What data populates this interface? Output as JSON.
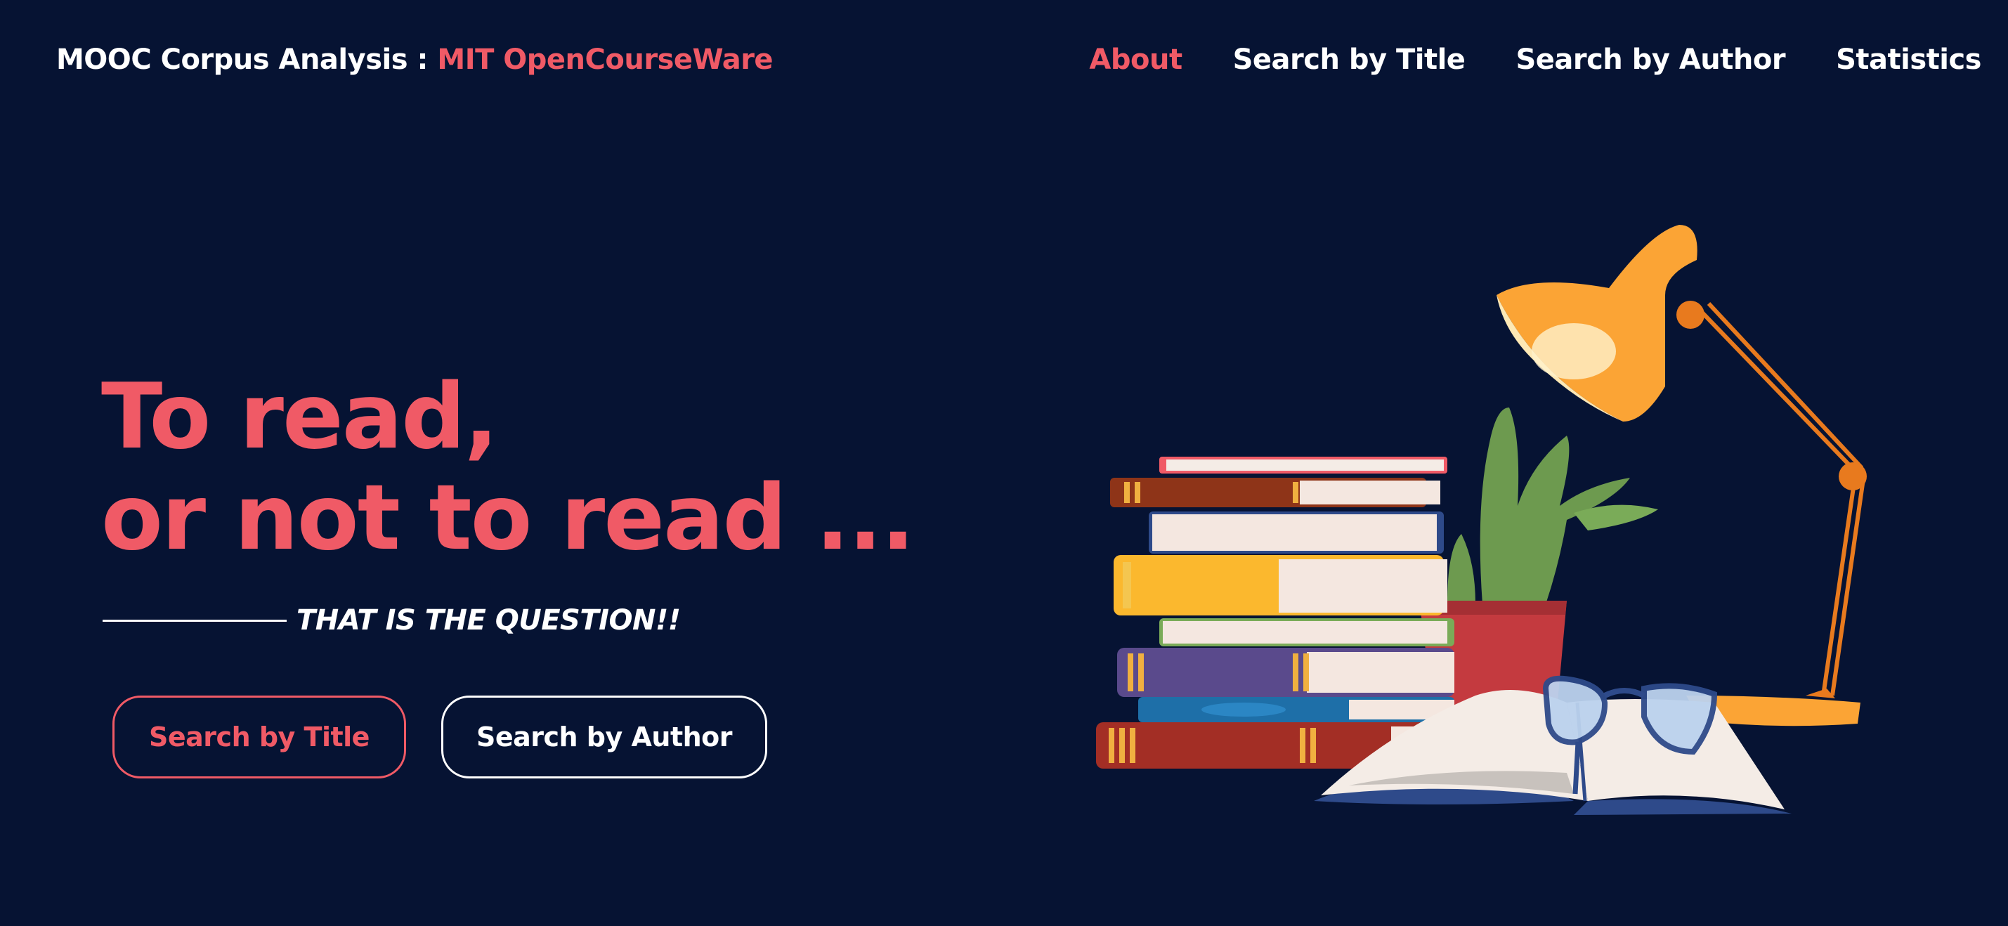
{
  "brand": {
    "prefix": "MOOC Corpus Analysis : ",
    "accent": "MIT OpenCourseWare"
  },
  "nav": {
    "items": [
      {
        "label": "About",
        "active": true
      },
      {
        "label": "Search by Title",
        "active": false
      },
      {
        "label": "Search by Author",
        "active": false
      },
      {
        "label": "Statistics",
        "active": false
      }
    ]
  },
  "hero": {
    "title_line1": "To read,",
    "title_line2": "or not to read ...",
    "tagline": "THAT IS THE QUESTION!!",
    "buttons": {
      "search_title": "Search by Title",
      "search_author": "Search by Author"
    }
  },
  "colors": {
    "background": "#061333",
    "accent": "#f05a66",
    "text": "#ffffff"
  },
  "icons": {
    "illustration": "books-lamp-plant-glasses-illustration"
  }
}
